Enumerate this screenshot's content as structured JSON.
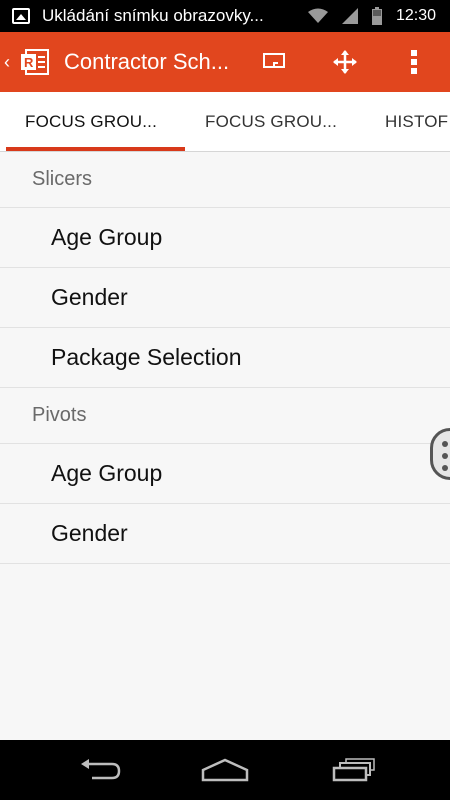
{
  "status_bar": {
    "notification_text": "Ukládání snímku obrazovky...",
    "time": "12:30",
    "icons": [
      "image-notification-icon",
      "wifi-icon",
      "signal-icon",
      "battery-icon"
    ]
  },
  "app_bar": {
    "title": "Contractor Sch...",
    "colors": {
      "background": "#e1461e"
    },
    "actions": [
      "present-icon",
      "move-icon",
      "overflow-menu-icon"
    ]
  },
  "tabs": [
    {
      "label": "FOCUS GROU...",
      "active": true
    },
    {
      "label": "FOCUS GROU...",
      "active": false
    },
    {
      "label": "HISTOF",
      "active": false
    }
  ],
  "sections": [
    {
      "header": "Slicers",
      "items": [
        "Age Group",
        "Gender",
        "Package Selection"
      ]
    },
    {
      "header": "Pivots",
      "items": [
        "Age Group",
        "Gender"
      ]
    }
  ],
  "nav_bar": {
    "buttons": [
      "back-icon",
      "home-icon",
      "recent-apps-icon"
    ]
  }
}
